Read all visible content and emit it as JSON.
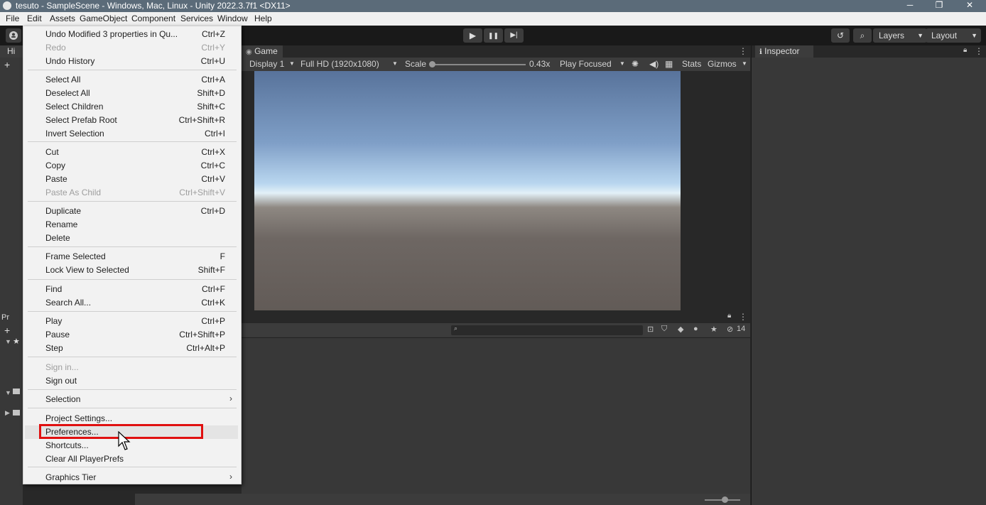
{
  "window": {
    "title": "tesuto - SampleScene - Windows, Mac, Linux - Unity 2022.3.7f1 <DX11>",
    "minimize": "─",
    "maximize": "❐",
    "close": "✕"
  },
  "menubar": [
    "File",
    "Edit",
    "Assets",
    "GameObject",
    "Component",
    "Services",
    "Window",
    "Help"
  ],
  "toolbar": {
    "play": "▶",
    "pause": "❚❚",
    "step": "▶|",
    "layers": "Layers",
    "layout": "Layout"
  },
  "hierarchy": {
    "tab_partial": "Hi"
  },
  "project": {
    "tab_partial": "Pr",
    "hidden_count": "14"
  },
  "game": {
    "tab": "Game",
    "display": "Display 1",
    "resolution": "Full HD (1920x1080)",
    "scale_label": "Scale",
    "scale_value": "0.43x",
    "play_mode": "Play Focused",
    "stats": "Stats",
    "gizmos": "Gizmos"
  },
  "inspector": {
    "tab": "Inspector"
  },
  "edit_menu": {
    "items": [
      {
        "label": "Undo Modified 3 properties in Qu...",
        "shortcut": "Ctrl+Z",
        "enabled": true
      },
      {
        "label": "Redo",
        "shortcut": "Ctrl+Y",
        "enabled": false
      },
      {
        "label": "Undo History",
        "shortcut": "Ctrl+U",
        "enabled": true
      },
      {
        "label": "Select All",
        "shortcut": "Ctrl+A",
        "enabled": true
      },
      {
        "label": "Deselect All",
        "shortcut": "Shift+D",
        "enabled": true
      },
      {
        "label": "Select Children",
        "shortcut": "Shift+C",
        "enabled": true
      },
      {
        "label": "Select Prefab Root",
        "shortcut": "Ctrl+Shift+R",
        "enabled": true
      },
      {
        "label": "Invert Selection",
        "shortcut": "Ctrl+I",
        "enabled": true
      },
      {
        "label": "Cut",
        "shortcut": "Ctrl+X",
        "enabled": true
      },
      {
        "label": "Copy",
        "shortcut": "Ctrl+C",
        "enabled": true
      },
      {
        "label": "Paste",
        "shortcut": "Ctrl+V",
        "enabled": true
      },
      {
        "label": "Paste As Child",
        "shortcut": "Ctrl+Shift+V",
        "enabled": false
      },
      {
        "label": "Duplicate",
        "shortcut": "Ctrl+D",
        "enabled": true
      },
      {
        "label": "Rename",
        "shortcut": "",
        "enabled": true
      },
      {
        "label": "Delete",
        "shortcut": "",
        "enabled": true
      },
      {
        "label": "Frame Selected",
        "shortcut": "F",
        "enabled": true
      },
      {
        "label": "Lock View to Selected",
        "shortcut": "Shift+F",
        "enabled": true
      },
      {
        "label": "Find",
        "shortcut": "Ctrl+F",
        "enabled": true
      },
      {
        "label": "Search All...",
        "shortcut": "Ctrl+K",
        "enabled": true
      },
      {
        "label": "Play",
        "shortcut": "Ctrl+P",
        "enabled": true
      },
      {
        "label": "Pause",
        "shortcut": "Ctrl+Shift+P",
        "enabled": true
      },
      {
        "label": "Step",
        "shortcut": "Ctrl+Alt+P",
        "enabled": true
      },
      {
        "label": "Sign in...",
        "shortcut": "",
        "enabled": false
      },
      {
        "label": "Sign out",
        "shortcut": "",
        "enabled": true
      },
      {
        "label": "Selection",
        "shortcut": "",
        "enabled": true,
        "submenu": true
      },
      {
        "label": "Project Settings...",
        "shortcut": "",
        "enabled": true
      },
      {
        "label": "Preferences...",
        "shortcut": "",
        "enabled": true,
        "highlighted": true
      },
      {
        "label": "Shortcuts...",
        "shortcut": "",
        "enabled": true
      },
      {
        "label": "Clear All PlayerPrefs",
        "shortcut": "",
        "enabled": true
      },
      {
        "label": "Graphics Tier",
        "shortcut": "",
        "enabled": true,
        "submenu": true
      }
    ]
  },
  "colors": {
    "highlight_box": "#e01010",
    "titlebar": "#5b6b79",
    "menu_bg": "#f2f2f2"
  }
}
